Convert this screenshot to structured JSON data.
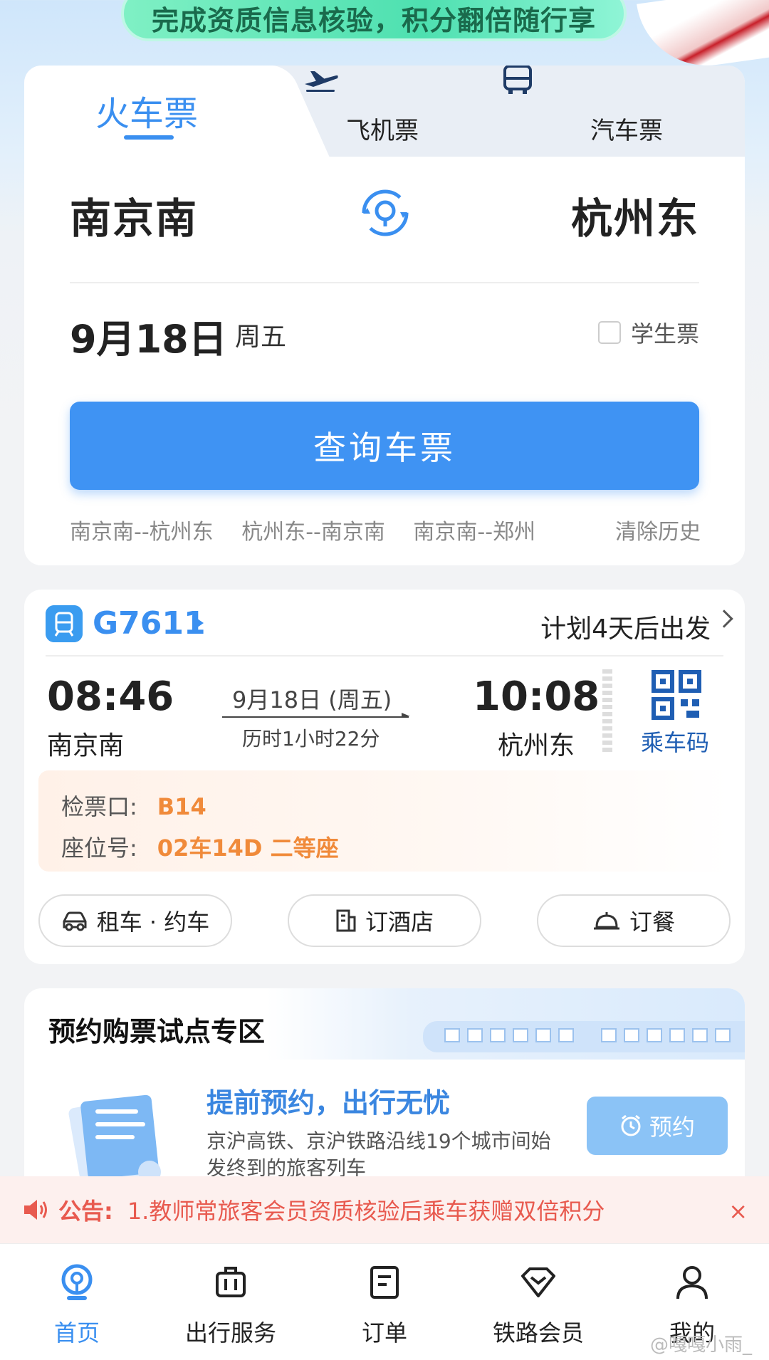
{
  "banner": {
    "text": "完成资质信息核验，积分翻倍随行享"
  },
  "tabs": [
    {
      "label": "火车票"
    },
    {
      "label": "飞机票"
    },
    {
      "label": "汽车票"
    }
  ],
  "booking": {
    "from": "南京南",
    "to": "杭州东",
    "date": "9月18日",
    "weekday": "周五",
    "student_label": "学生票",
    "search_label": "查询车票",
    "history": [
      "南京南--杭州东",
      "杭州东--南京南",
      "南京南--郑州"
    ],
    "clear_history": "清除历史"
  },
  "trip": {
    "train_number": "G7611",
    "plan_text": "计划4天后出发",
    "departure_time": "08:46",
    "departure_station": "南京南",
    "arrival_time": "10:08",
    "arrival_station": "杭州东",
    "travel_date": "9月18日 (周五)",
    "duration": "历时1小时22分",
    "qr_label": "乘车码",
    "gate_label": "检票口:",
    "gate_value": "B14",
    "seat_label": "座位号:",
    "seat_value": "02车14D 二等座",
    "services": [
      "租车 · 约车",
      "订酒店",
      "订餐"
    ]
  },
  "pilot": {
    "title": "预约购票试点专区",
    "promo_title": "提前预约，出行无忧",
    "promo_desc": "京沪高铁、京沪铁路沿线19个城市间始发终到的旅客列车",
    "reserve_label": "预约"
  },
  "notice": {
    "label": "公告:",
    "text": "1.教师常旅客会员资质核验后乘车获赠双倍积分",
    "close": "×"
  },
  "nav": [
    {
      "label": "首页",
      "icon": "home-icon"
    },
    {
      "label": "出行服务",
      "icon": "luggage-icon"
    },
    {
      "label": "订单",
      "icon": "order-icon"
    },
    {
      "label": "铁路会员",
      "icon": "diamond-icon"
    },
    {
      "label": "我的",
      "icon": "user-icon"
    }
  ],
  "watermark": "@嘎嘎小雨_",
  "colors": {
    "accent": "#3a8ff0",
    "notice": "#e85a4f",
    "seat": "#f08a3a"
  }
}
